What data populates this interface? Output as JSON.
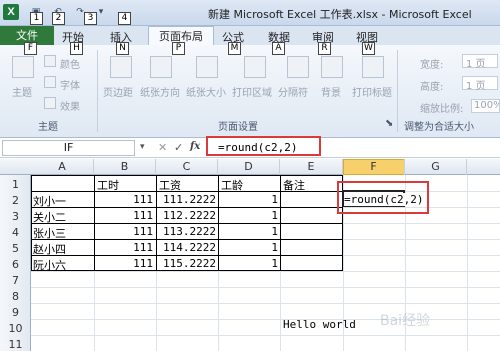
{
  "window": {
    "title": "新建 Microsoft Excel 工作表.xlsx - Microsoft Excel"
  },
  "quick_access": {
    "items": [
      "1",
      "2",
      "3",
      "4"
    ]
  },
  "keytips": [
    "F",
    "H",
    "N",
    "P",
    "M",
    "A",
    "R",
    "W"
  ],
  "tabs": [
    "文件",
    "开始",
    "插入",
    "页面布局",
    "公式",
    "数据",
    "审阅",
    "视图"
  ],
  "ribbon": {
    "theme_group": {
      "label": "主题",
      "buttons": [
        "主题",
        "颜色",
        "字体",
        "效果"
      ]
    },
    "page_setup_group": {
      "label": "页面设置",
      "buttons": [
        "页边距",
        "纸张方向",
        "纸张大小",
        "打印区域",
        "分隔符",
        "背景",
        "打印标题"
      ]
    },
    "scale_group": {
      "label": "调整为合适大小",
      "width_label": "宽度:",
      "width_value": "1 页",
      "height_label": "高度:",
      "height_value": "1 页",
      "scale_label": "缩放比例:",
      "scale_value": "100%"
    }
  },
  "formula_bar": {
    "name_box": "IF",
    "fx": "fx",
    "formula": "=round(c2,2)"
  },
  "columns": [
    "A",
    "B",
    "C",
    "D",
    "E",
    "F",
    "G"
  ],
  "rows": [
    "1",
    "2",
    "3",
    "4",
    "5",
    "6",
    "7",
    "8",
    "9",
    "10",
    "11"
  ],
  "headers": {
    "B": "工时",
    "C": "工资",
    "D": "工龄",
    "E": "备注"
  },
  "data": [
    {
      "name": "刘小一",
      "hours": "111",
      "pay": "111.2222",
      "years": "1"
    },
    {
      "name": "关小二",
      "hours": "111",
      "pay": "112.2222",
      "years": "1"
    },
    {
      "name": "张小三",
      "hours": "111",
      "pay": "113.2222",
      "years": "1"
    },
    {
      "name": "赵小四",
      "hours": "111",
      "pay": "114.2222",
      "years": "1"
    },
    {
      "name": "阮小六",
      "hours": "111",
      "pay": "115.2222",
      "years": "1"
    }
  ],
  "active_cell": {
    "content": "=round(c2,2)"
  },
  "note": {
    "text": "Hello world"
  },
  "watermark": "Bai经验"
}
